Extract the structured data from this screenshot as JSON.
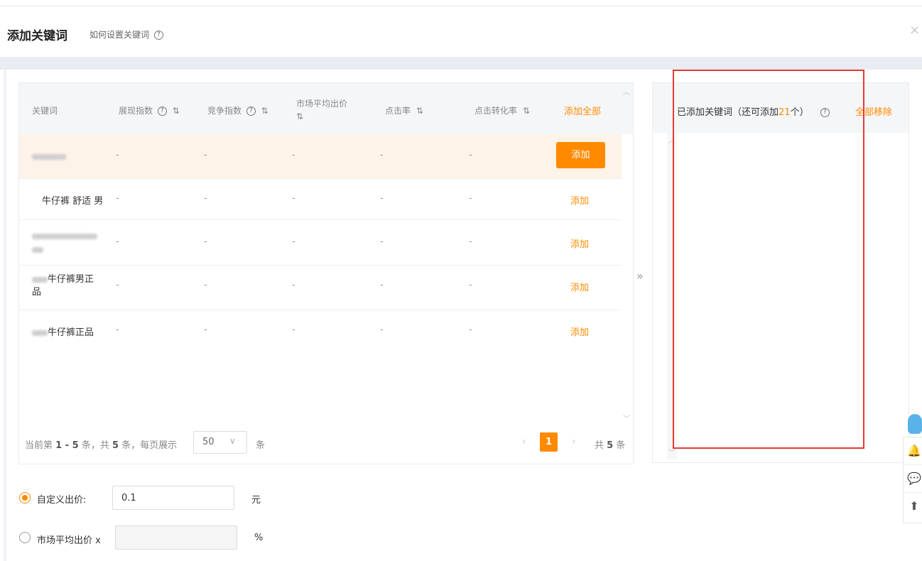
{
  "dialog": {
    "title": "添加关键词",
    "help_link": "如何设置关键词",
    "close_glyph": "×"
  },
  "table": {
    "headers": {
      "keyword": "关键词",
      "impression_index": "展现指数",
      "competition_index": "竞争指数",
      "market_avg_bid_line1": "市场平均出价",
      "ctr": "点击率",
      "cvr": "点击转化率",
      "sort_glyph": "⇅",
      "add_all": "添加全部"
    },
    "rows": [
      {
        "keyword": "",
        "dash": "-",
        "action": "添加",
        "highlighted": true
      },
      {
        "keyword": "牛仔裤 舒适 男",
        "dash": "-",
        "action": "添加"
      },
      {
        "keyword": "",
        "dash": "-",
        "action": "添加"
      },
      {
        "keyword": "牛仔裤男正",
        "keyword_line2": "品",
        "dash": "-",
        "action": "添加"
      },
      {
        "keyword": "牛仔裤正品",
        "dash": "-",
        "action": "添加"
      }
    ],
    "pagination": {
      "info_prefix": "当前第",
      "range": "1 - 5",
      "info_mid": "条，共",
      "total": "5",
      "info_suffix": "条，每页展示",
      "page_size": "50",
      "unit": "条",
      "current_page": "1",
      "total_prefix": "共",
      "total_suffix": "条"
    }
  },
  "transfer_glyph": "»",
  "added_panel": {
    "title_prefix": "已添加关键词（还可添加",
    "remaining": "21",
    "title_suffix": "个）",
    "remove_all": "全部移除"
  },
  "bid": {
    "custom_label": "自定义出价:",
    "custom_value": "0.1",
    "custom_unit": "元",
    "market_label": "市场平均出价 x",
    "market_value": "",
    "market_unit": "%"
  },
  "side_tools": {
    "bell": "🔔",
    "chat": "💬",
    "top": "⬆"
  },
  "colors": {
    "accent": "#ff8a00",
    "highlight_row": "#fdf3e9",
    "annotation_red": "#e53935"
  }
}
